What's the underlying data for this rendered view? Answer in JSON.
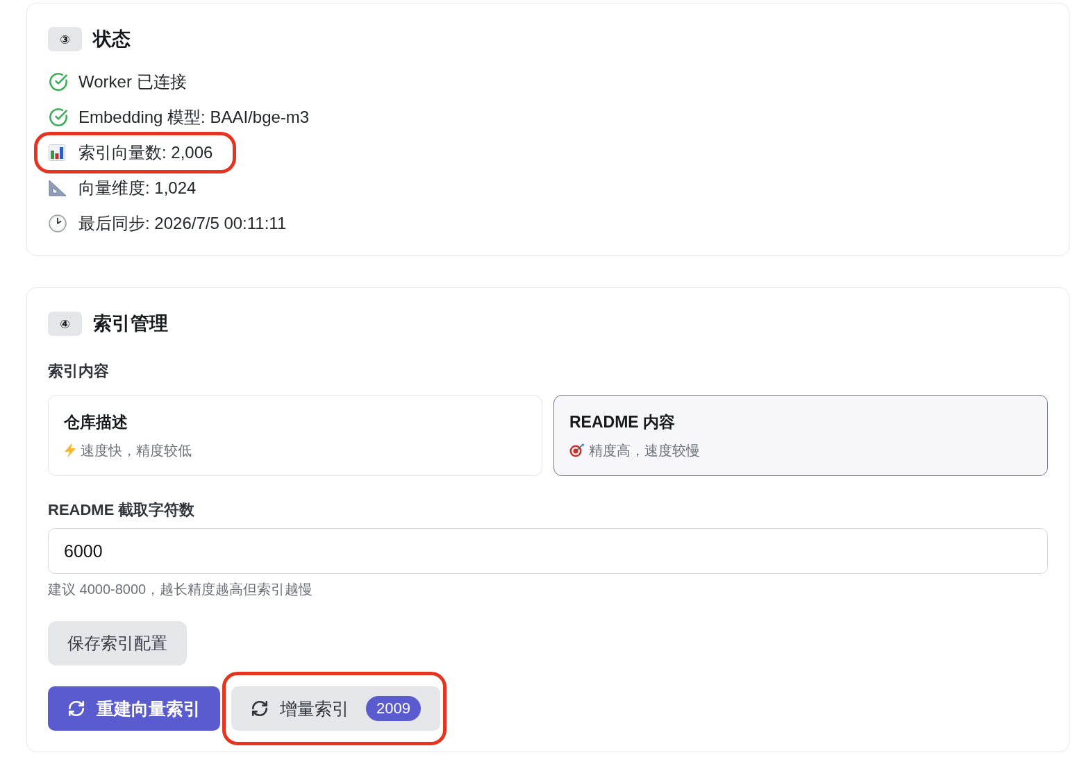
{
  "status_card": {
    "badge": "③",
    "title": "状态",
    "items": [
      {
        "kind": "check",
        "text": "Worker 已连接",
        "highlighted": false
      },
      {
        "kind": "check",
        "text": "Embedding 模型: BAAI/bge-m3",
        "highlighted": false
      },
      {
        "kind": "count",
        "text": "索引向量数: 2,006",
        "highlighted": true
      },
      {
        "kind": "dimension",
        "text": "向量维度: 1,024",
        "highlighted": false
      },
      {
        "kind": "sync",
        "text": "最后同步: 2026/7/5 00:11:11",
        "highlighted": false
      }
    ]
  },
  "index_card": {
    "badge": "④",
    "title": "索引管理",
    "content_label": "索引内容",
    "options": [
      {
        "kind": "speed",
        "title": "仓库描述",
        "description": "速度快，精度较低",
        "selected": false
      },
      {
        "kind": "precision",
        "title": "README 内容",
        "description": "精度高，速度较慢",
        "selected": true
      }
    ],
    "readme_chars": {
      "label": "README 截取字符数",
      "value": "6000",
      "hint": "建议 4000-8000，越长精度越高但索引越慢"
    },
    "save_button": {
      "label": "保存索引配置"
    },
    "actions": [
      {
        "kind": "primary",
        "label": "重建向量索引",
        "highlighted": false
      },
      {
        "kind": "secondary",
        "label": "增量索引",
        "count": "2009",
        "highlighted": true
      }
    ]
  }
}
